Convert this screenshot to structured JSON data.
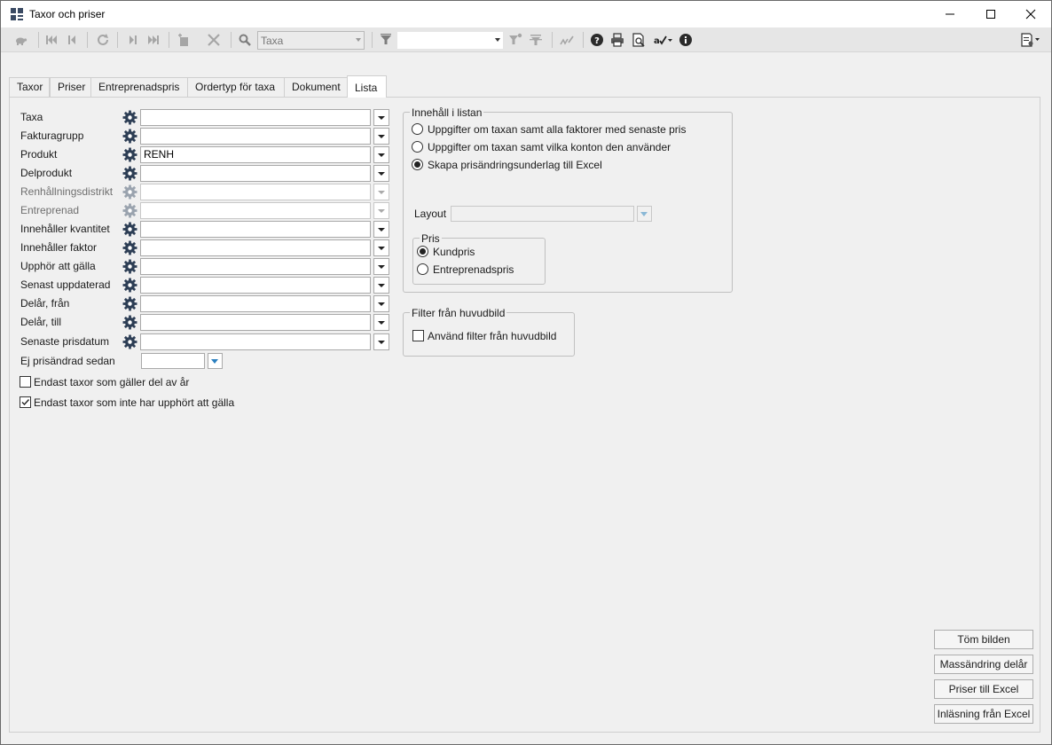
{
  "window": {
    "title": "Taxor och priser"
  },
  "toolbar": {
    "search_value": "Taxa",
    "filter_value": ""
  },
  "tabs": [
    {
      "label": "Taxor"
    },
    {
      "label": "Priser"
    },
    {
      "label": "Entreprenadspris"
    },
    {
      "label": "Ordertyp för taxa"
    },
    {
      "label": "Dokument"
    },
    {
      "label": "Lista"
    }
  ],
  "active_tab": "Lista",
  "form": {
    "fields": [
      {
        "label": "Taxa",
        "value": ""
      },
      {
        "label": "Fakturagrupp",
        "value": ""
      },
      {
        "label": "Produkt",
        "value": "RENH"
      },
      {
        "label": "Delprodukt",
        "value": ""
      },
      {
        "label": "Renhållningsdistrikt",
        "value": "",
        "disabled": true
      },
      {
        "label": "Entreprenad",
        "value": "",
        "disabled": true
      },
      {
        "label": "Innehåller kvantitet",
        "value": ""
      },
      {
        "label": "Innehåller faktor",
        "value": ""
      },
      {
        "label": "Upphör att gälla",
        "value": ""
      },
      {
        "label": "Senast uppdaterad",
        "value": ""
      },
      {
        "label": "Delår, från",
        "value": ""
      },
      {
        "label": "Delår, till",
        "value": ""
      },
      {
        "label": "Senaste prisdatum",
        "value": ""
      }
    ],
    "not_changed_since": {
      "label": "Ej prisändrad sedan",
      "value": ""
    },
    "checkbox_part_year": {
      "label": "Endast taxor som gäller del av år",
      "checked": false
    },
    "checkbox_not_expired": {
      "label": "Endast taxor som inte har upphört att gälla",
      "checked": true
    }
  },
  "content_group": {
    "legend": "Innehåll i listan",
    "options": [
      {
        "label": "Uppgifter om taxan samt alla faktorer med senaste pris",
        "selected": false
      },
      {
        "label": "Uppgifter om taxan samt vilka konton den använder",
        "selected": false
      },
      {
        "label": "Skapa prisändringsunderlag till Excel",
        "selected": true
      }
    ],
    "layout_label": "Layout",
    "layout_value": "",
    "price_group": {
      "legend": "Pris",
      "options": [
        {
          "label": "Kundpris",
          "selected": true
        },
        {
          "label": "Entreprenadspris",
          "selected": false
        }
      ]
    }
  },
  "filter_group": {
    "legend": "Filter från huvudbild",
    "checkbox": {
      "label": "Använd filter från huvudbild",
      "checked": false
    }
  },
  "buttons": {
    "clear": "Töm bilden",
    "mass_change": "Massändring delår",
    "prices_to_excel": "Priser till Excel",
    "import_from_excel": "Inläsning från Excel"
  },
  "colors": {
    "accent": "#2a7fbf",
    "icon_dark": "#3a4a63"
  }
}
